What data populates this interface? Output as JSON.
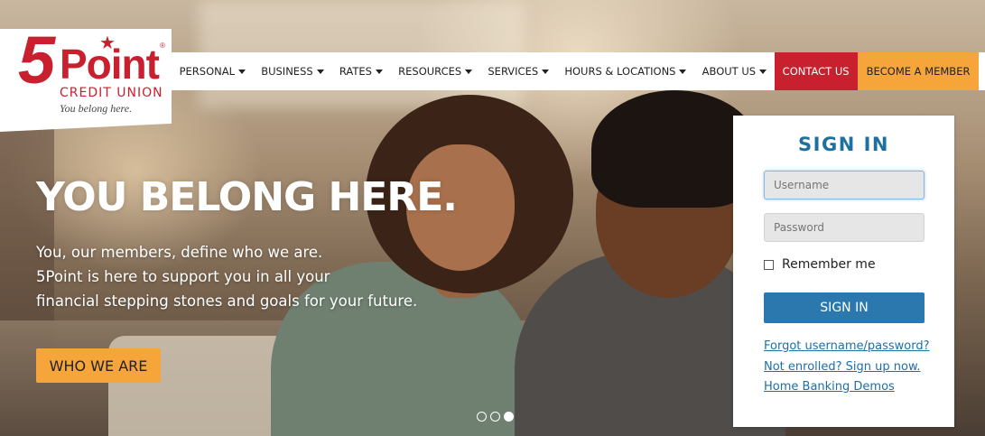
{
  "logo": {
    "five": "5",
    "point": "Point",
    "star": "★",
    "registered": "®",
    "credit_union": "CREDIT UNION",
    "tagline": "You belong here."
  },
  "nav": {
    "items": [
      {
        "label": "PERSONAL"
      },
      {
        "label": "BUSINESS"
      },
      {
        "label": "RATES"
      },
      {
        "label": "RESOURCES"
      },
      {
        "label": "SERVICES"
      },
      {
        "label": "HOURS & LOCATIONS"
      },
      {
        "label": "ABOUT US"
      }
    ],
    "contact": "CONTACT US",
    "member": "BECOME A MEMBER",
    "search_icon": "search-icon"
  },
  "hero": {
    "title": "YOU BELONG HERE.",
    "lines": [
      "You, our members, define who we are.",
      "5Point is here to support you in all your",
      "financial stepping stones and goals for your future."
    ],
    "cta": "WHO WE ARE",
    "slides_total": 3,
    "slide_active": 3
  },
  "signin": {
    "title": "SIGN IN",
    "username_placeholder": "Username",
    "password_placeholder": "Password",
    "remember": "Remember me",
    "button": "SIGN IN",
    "links": [
      "Forgot username/password?",
      "Not enrolled? Sign up now.",
      "Home Banking Demos"
    ]
  },
  "colors": {
    "brand_red": "#c8202f",
    "accent_orange": "#f5a53a",
    "signin_blue": "#2a78ad"
  }
}
